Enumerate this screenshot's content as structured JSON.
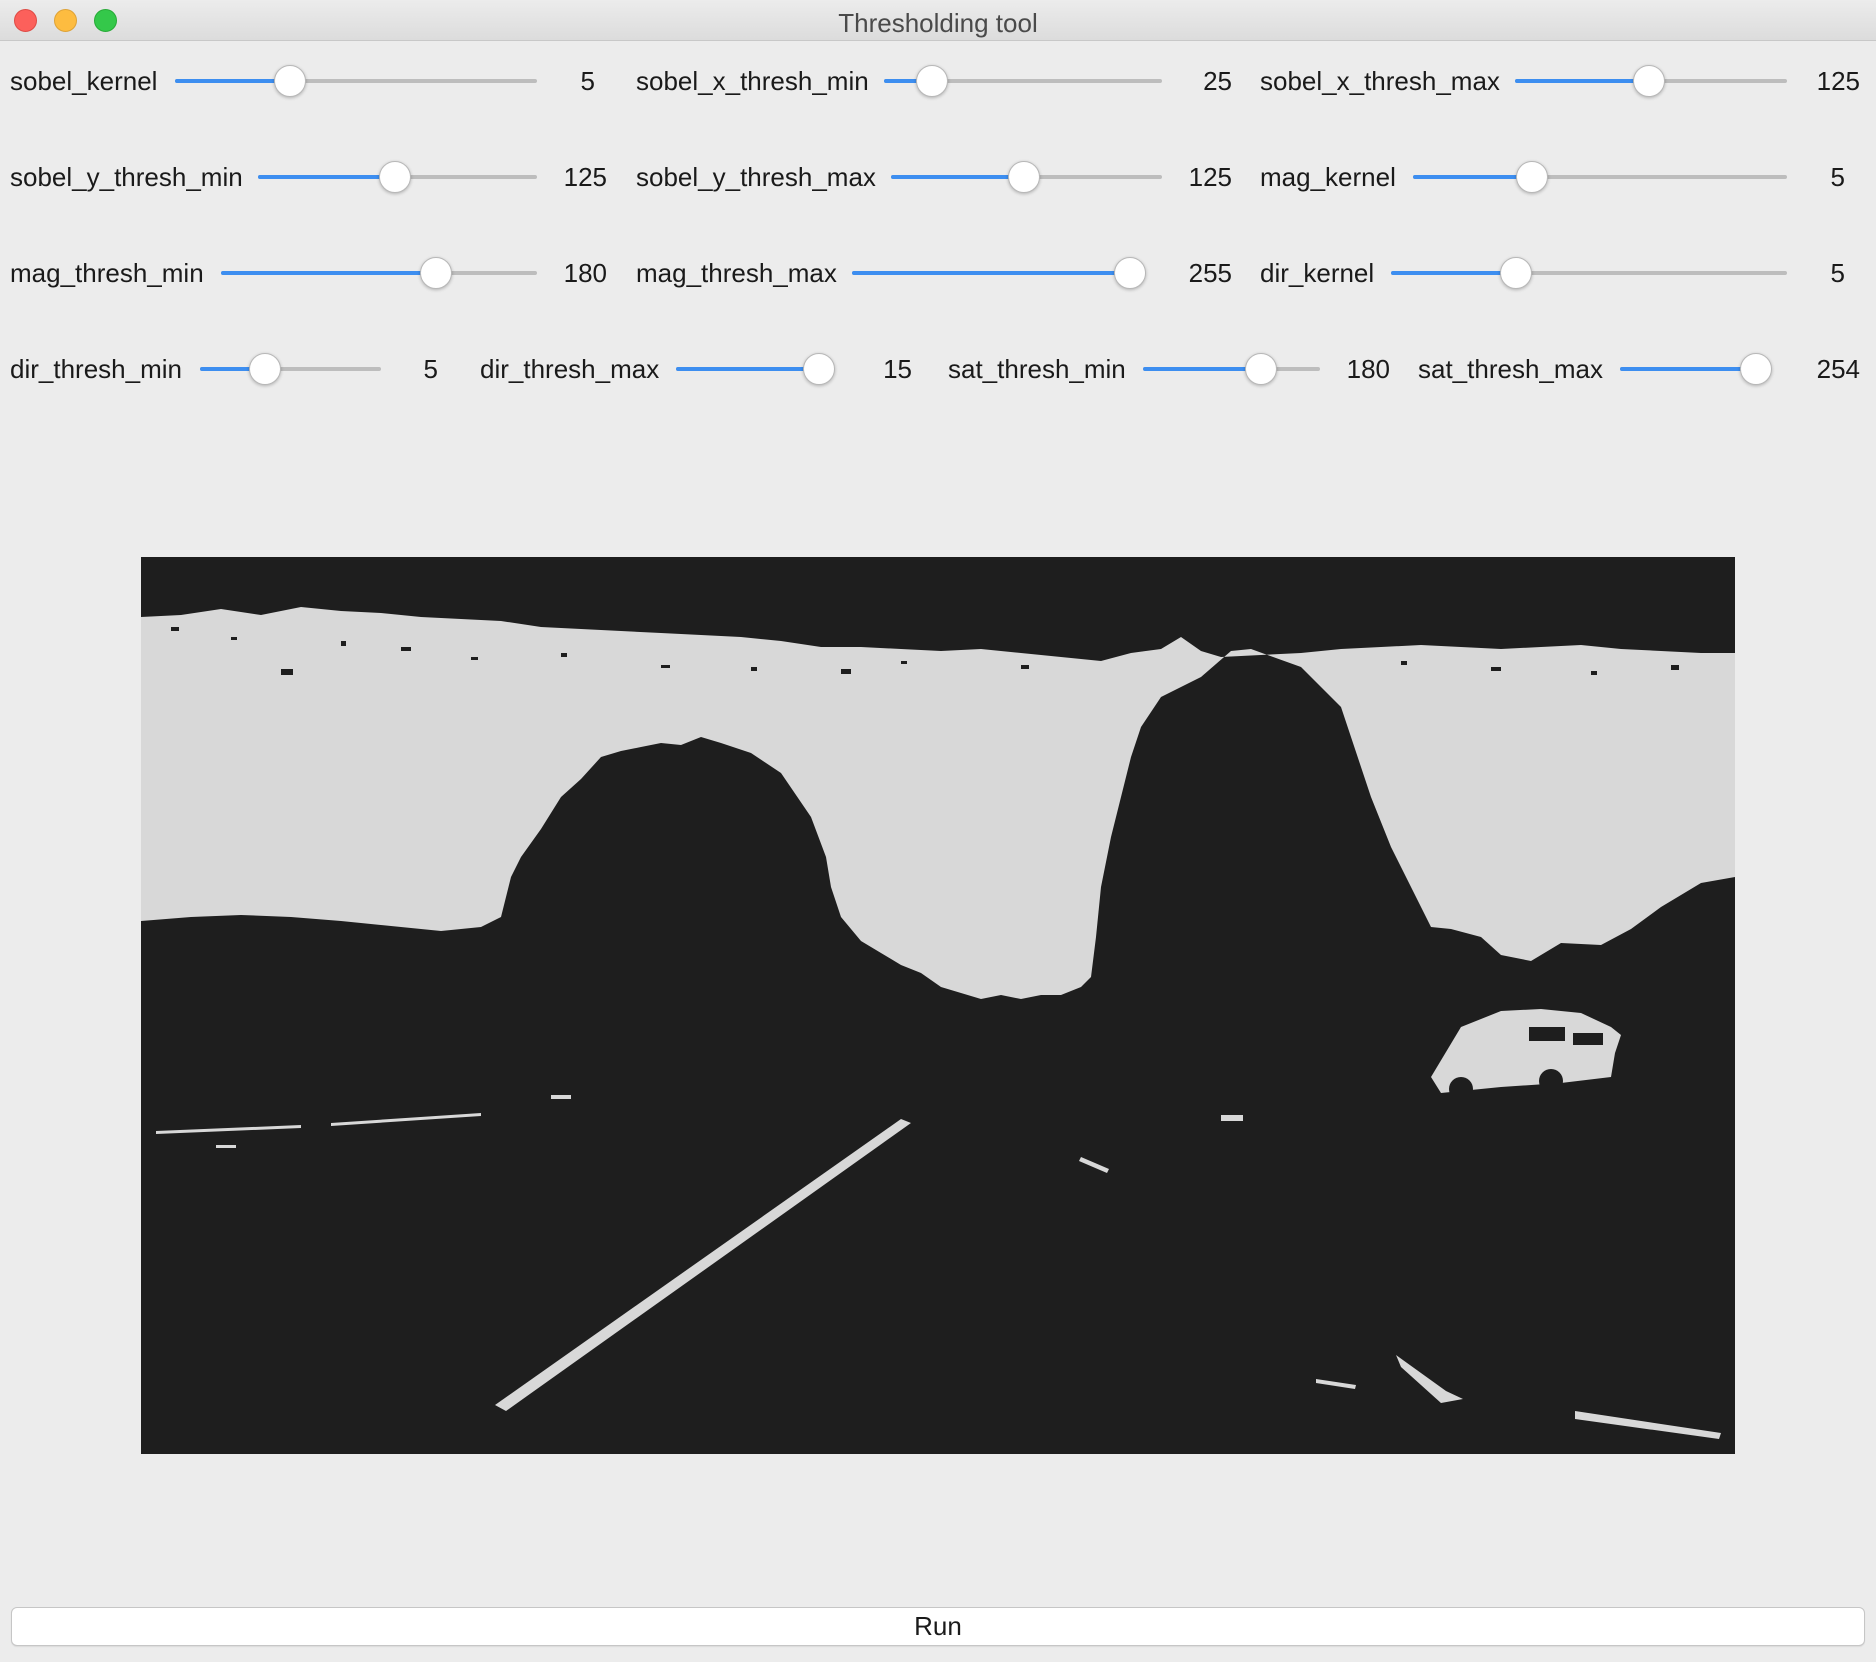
{
  "window": {
    "title": "Thresholding tool"
  },
  "sliders": {
    "sobel_kernel": {
      "label": "sobel_kernel",
      "value": "5",
      "fraction": 0.3
    },
    "sobel_x_thresh_min": {
      "label": "sobel_x_thresh_min",
      "value": "25",
      "fraction": 0.13
    },
    "sobel_x_thresh_max": {
      "label": "sobel_x_thresh_max",
      "value": "125",
      "fraction": 0.49
    },
    "sobel_y_thresh_min": {
      "label": "sobel_y_thresh_min",
      "value": "125",
      "fraction": 0.49
    },
    "sobel_y_thresh_max": {
      "label": "sobel_y_thresh_max",
      "value": "125",
      "fraction": 0.49
    },
    "mag_kernel": {
      "label": "mag_kernel",
      "value": "5",
      "fraction": 0.3
    },
    "mag_thresh_min": {
      "label": "mag_thresh_min",
      "value": "180",
      "fraction": 0.7
    },
    "mag_thresh_max": {
      "label": "mag_thresh_max",
      "value": "255",
      "fraction": 1.0
    },
    "dir_kernel": {
      "label": "dir_kernel",
      "value": "5",
      "fraction": 0.3
    },
    "dir_thresh_min": {
      "label": "dir_thresh_min",
      "value": "5",
      "fraction": 0.33
    },
    "dir_thresh_max": {
      "label": "dir_thresh_max",
      "value": "15",
      "fraction": 1.0
    },
    "sat_thresh_min": {
      "label": "sat_thresh_min",
      "value": "180",
      "fraction": 0.7
    },
    "sat_thresh_max": {
      "label": "sat_thresh_max",
      "value": "254",
      "fraction": 1.0
    }
  },
  "colors": {
    "accent": "#3d8ef0",
    "image_black": "#1e1e1e",
    "image_white": "#d8d8d8"
  },
  "run_button": {
    "label": "Run"
  }
}
